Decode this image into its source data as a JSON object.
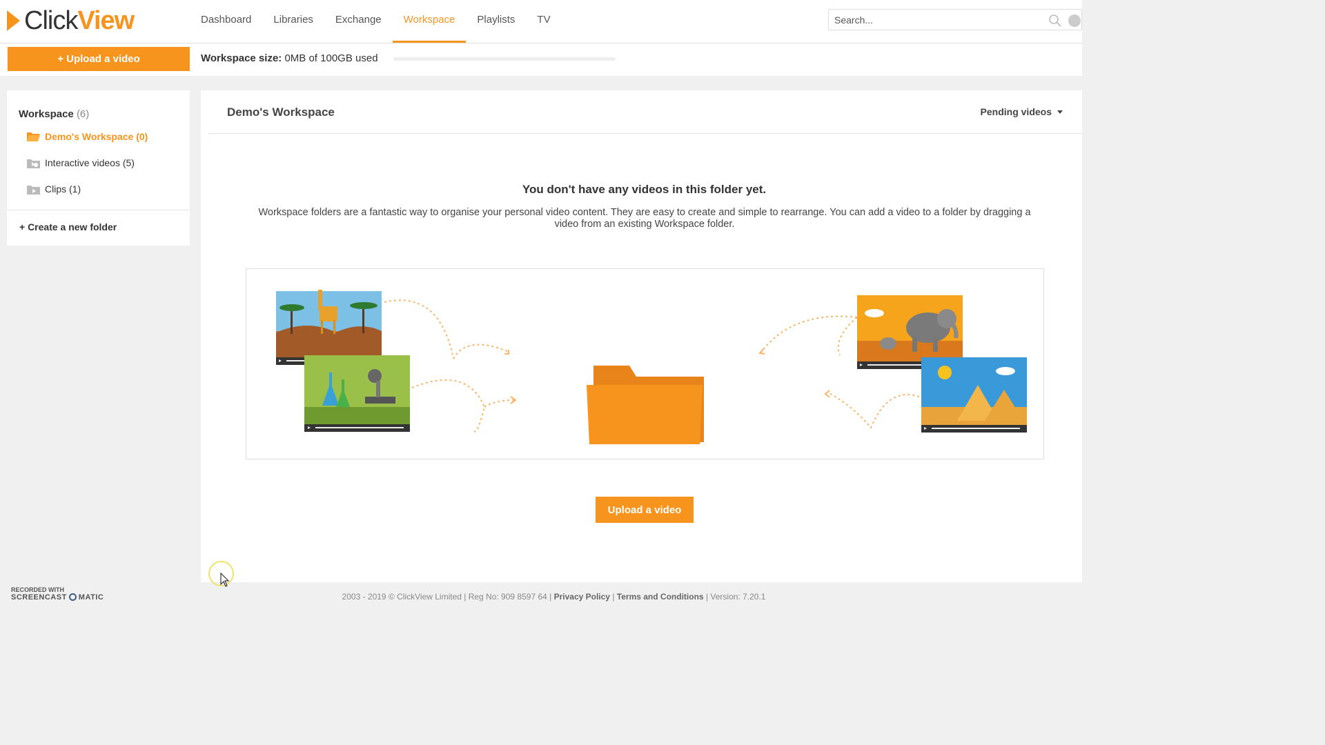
{
  "app": {
    "logo_click": "Click",
    "logo_view": "View"
  },
  "nav": {
    "items": [
      {
        "label": "Dashboard"
      },
      {
        "label": "Libraries"
      },
      {
        "label": "Exchange"
      },
      {
        "label": "Workspace"
      },
      {
        "label": "Playlists"
      },
      {
        "label": "TV"
      }
    ],
    "active": "Workspace"
  },
  "search": {
    "placeholder": "Search..."
  },
  "toolbar": {
    "upload_label": "+ Upload a video",
    "ws_size_label": "Workspace size:",
    "ws_size_value": "0MB of 100GB used",
    "usage_fraction": 0
  },
  "sidebar": {
    "title": "Workspace",
    "title_count": "(6)",
    "items": [
      {
        "label": "Demo's Workspace (0)"
      },
      {
        "label": "Interactive videos  (5)"
      },
      {
        "label": "Clips  (1)"
      }
    ],
    "create_label": "+ Create a new folder"
  },
  "main": {
    "title": "Demo's Workspace",
    "pending_label": "Pending videos",
    "empty_title": "You don't have any videos in this folder yet.",
    "empty_desc": "Workspace folders are a fantastic way to organise your personal video content. They are easy to create and simple to rearrange. You can add a video to a folder by dragging a video from an existing Workspace folder.",
    "upload_label": "Upload a video"
  },
  "footer": {
    "copyright": "2003 - 2019 © ClickView Limited | Reg No: 909 8597 64 |",
    "privacy": "Privacy Policy",
    "sep": "|",
    "terms": "Terms and Conditions",
    "version": "| Version: 7.20.1"
  },
  "watermark": {
    "line1": "RECORDED WITH",
    "line2a": "SCREENCAST",
    "line2b": "MATIC"
  },
  "colors": {
    "accent": "#f7941d"
  }
}
